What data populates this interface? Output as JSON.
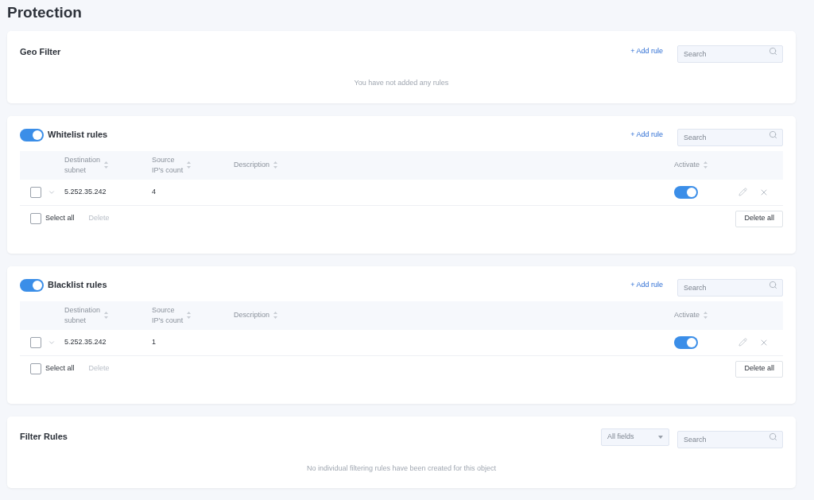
{
  "title": "Protection",
  "sections": [
    {
      "kind": "empty",
      "title": "Geo Filter",
      "add_rule": "+ Add rule",
      "search": {
        "placeholder": "Search"
      },
      "empty_text": "You have not added any rules"
    },
    {
      "kind": "table",
      "title": "Whitelist rules",
      "enabled": true,
      "add_rule": "+ Add rule",
      "search": {
        "placeholder": "Search"
      },
      "columns": [
        {
          "label": "Destination\nsubnet"
        },
        {
          "label": "Source\nIP's count"
        },
        {
          "label": "Description"
        },
        {
          "label": "Activate"
        }
      ],
      "rows": [
        {
          "checked": false,
          "subnet": "5.252.35.242",
          "count": "4",
          "active": true
        }
      ],
      "select_all": {
        "label": "Select all",
        "checked": false
      },
      "delete": {
        "label": "Delete",
        "disabled": true
      },
      "delete_all": "Delete all"
    },
    {
      "kind": "table",
      "title": "Blacklist rules",
      "enabled": true,
      "add_rule": "+ Add rule",
      "search": {
        "placeholder": "Search"
      },
      "columns": [
        {
          "label": "Destination\nsubnet"
        },
        {
          "label": "Source\nIP's count"
        },
        {
          "label": "Description"
        },
        {
          "label": "Activate"
        }
      ],
      "rows": [
        {
          "checked": false,
          "subnet": "5.252.35.242",
          "count": "1",
          "active": true
        }
      ],
      "select_all": {
        "label": "Select all",
        "checked": false
      },
      "delete": {
        "label": "Delete",
        "disabled": true
      },
      "delete_all": "Delete all"
    },
    {
      "kind": "filter",
      "title": "Filter Rules",
      "dropdown": "All fields",
      "search": {
        "placeholder": "Search"
      },
      "empty_text": "No individual filtering rules have been created for this object"
    }
  ]
}
